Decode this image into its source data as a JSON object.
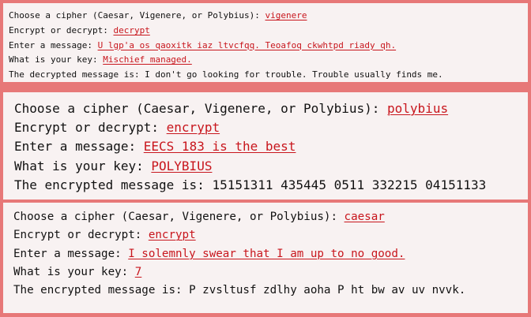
{
  "sessions": [
    {
      "cipher_prompt": "Choose a cipher (Caesar, Vigenere, or Polybius): ",
      "cipher": "vigenere",
      "mode_prompt": "Encrypt or decrypt: ",
      "mode": "decrypt",
      "message_prompt": "Enter a message: ",
      "message": "U lgp'a os qaoxitk iaz ltvcfqq. Teoafoq ckwhtpd riady qh.",
      "key_prompt": "What is your key: ",
      "key": "Mischief managed.",
      "result": "The decrypted message is: I don't go looking for trouble. Trouble usually finds me."
    },
    {
      "cipher_prompt": "Choose a cipher (Caesar, Vigenere, or Polybius): ",
      "cipher": "polybius",
      "mode_prompt": "Encrypt or decrypt: ",
      "mode": "encrypt",
      "message_prompt": "Enter a message: ",
      "message": "EECS 183 is the best",
      "key_prompt": "What is your key: ",
      "key": "POLYBIUS",
      "result": "The encrypted message is: 15151311 435445 0511 332215 04151133"
    },
    {
      "cipher_prompt": "Choose a cipher (Caesar, Vigenere, or Polybius): ",
      "cipher": "caesar",
      "mode_prompt": "Encrypt or decrypt: ",
      "mode": "encrypt",
      "message_prompt": "Enter a message: ",
      "message": "I solemnly swear that I am up to no good.",
      "key_prompt": "What is your key: ",
      "key": "7",
      "result": "The encrypted message is: P zvsltusf zdlhy aoha P ht bw av uv nvvk."
    }
  ]
}
